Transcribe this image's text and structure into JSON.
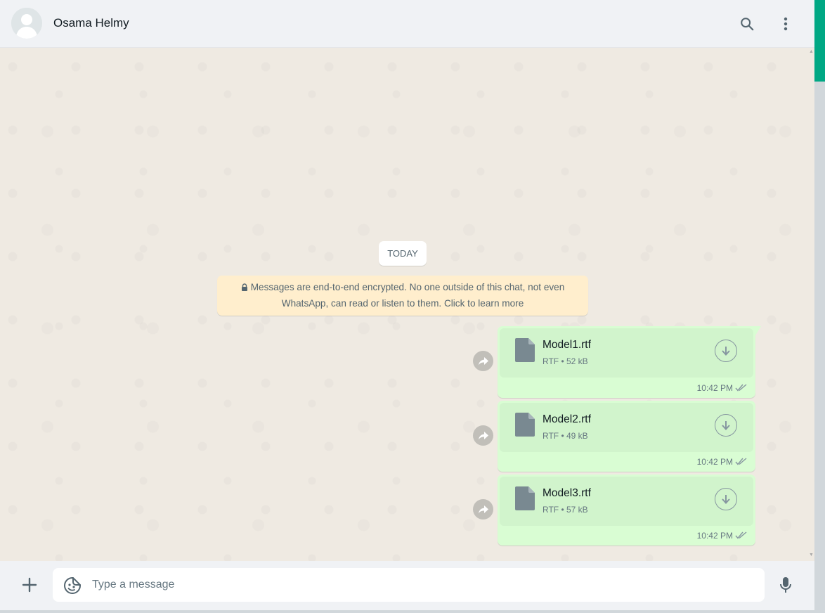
{
  "header": {
    "contact_name": "Osama Helmy",
    "avatar_icon": "default-avatar-icon",
    "search_icon": "search-icon",
    "menu_icon": "vertical-dots-icon"
  },
  "chat": {
    "date_separator": "TODAY",
    "encryption_notice": "Messages are end-to-end encrypted. No one outside of this chat, not even WhatsApp, can read or listen to them. Click to learn more",
    "messages": [
      {
        "file_name": "Model1.rtf",
        "file_type": "RTF",
        "file_size": "52 kB",
        "time": "10:42 PM",
        "status": "delivered"
      },
      {
        "file_name": "Model2.rtf",
        "file_type": "RTF",
        "file_size": "49 kB",
        "time": "10:42 PM",
        "status": "delivered"
      },
      {
        "file_name": "Model3.rtf",
        "file_type": "RTF",
        "file_size": "57 kB",
        "time": "10:42 PM",
        "status": "delivered"
      }
    ],
    "meta_separator": "•"
  },
  "composer": {
    "placeholder": "Type a message",
    "value": ""
  },
  "colors": {
    "accent": "#00a884",
    "outgoing_bubble": "#d9fdd3",
    "notice_bg": "#ffeecd",
    "chat_bg": "#efeae2",
    "header_bg": "#f0f2f5"
  }
}
